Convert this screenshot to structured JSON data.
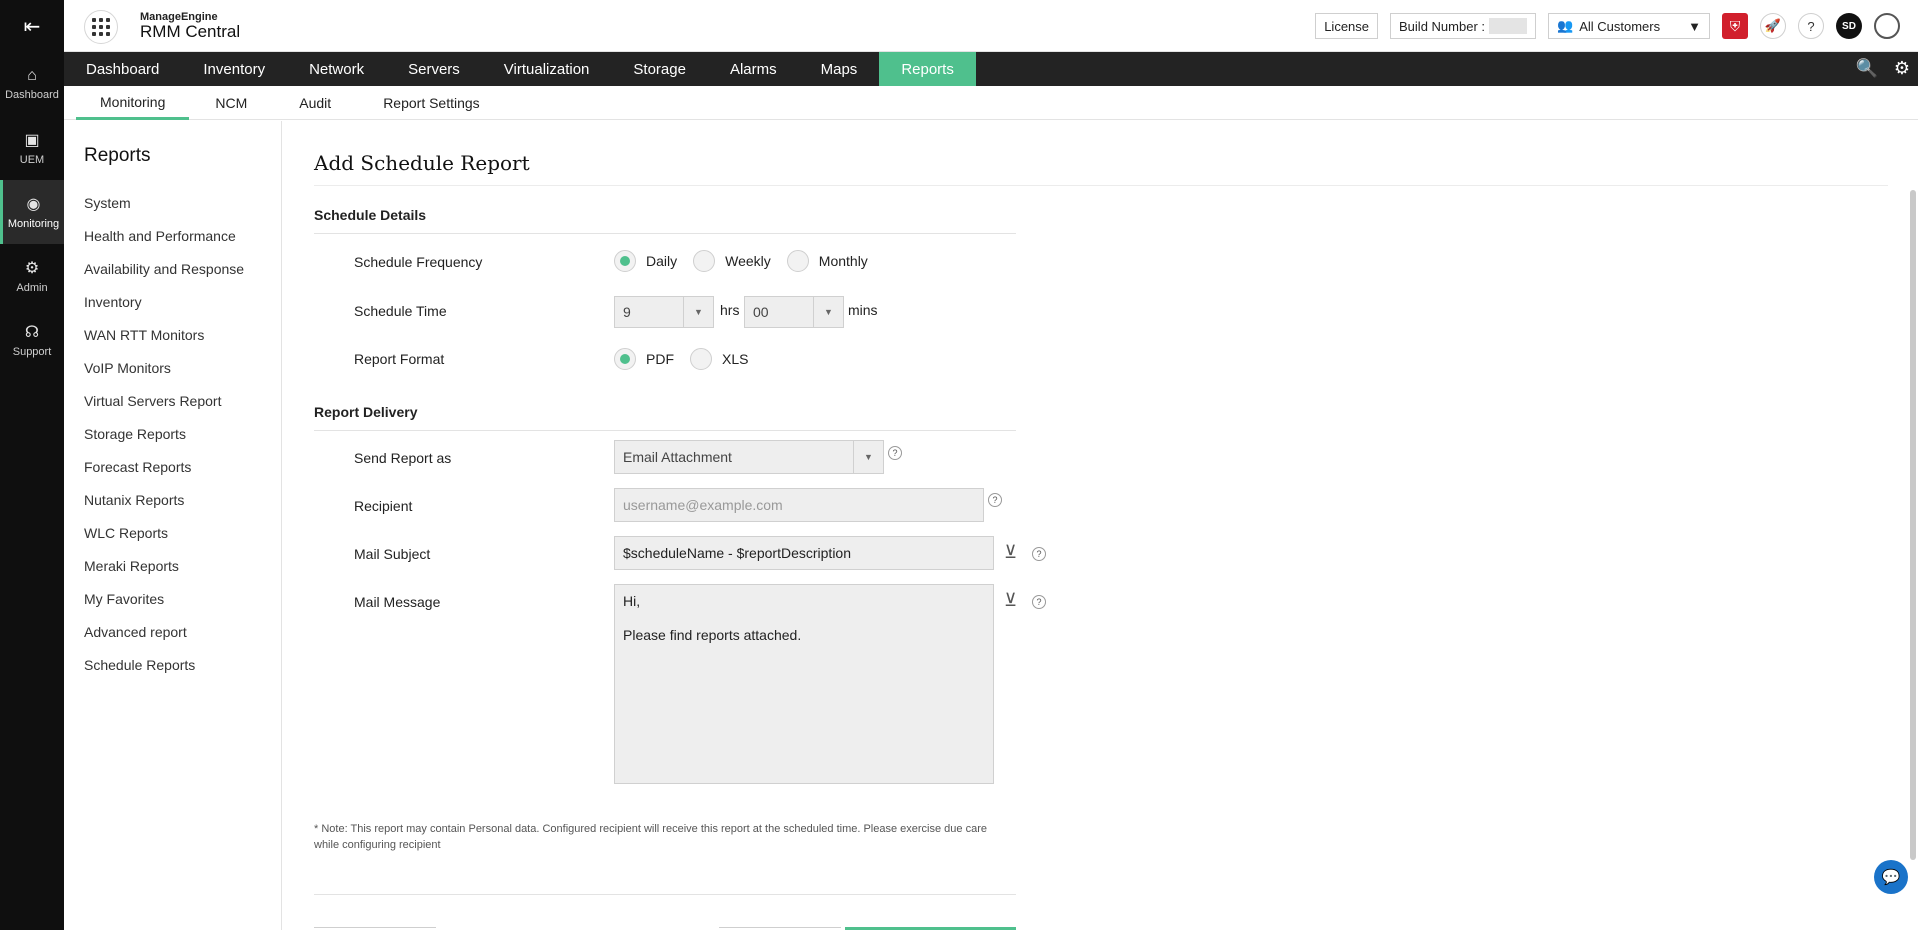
{
  "rail": {
    "items": [
      {
        "label": "Dashboard",
        "icon": "home-icon"
      },
      {
        "label": "UEM",
        "icon": "uem-icon"
      },
      {
        "label": "Monitoring",
        "icon": "monitoring-icon"
      },
      {
        "label": "Admin",
        "icon": "admin-icon"
      },
      {
        "label": "Support",
        "icon": "headset-icon"
      }
    ]
  },
  "brand": {
    "small": "ManageEngine",
    "big": "RMM Central"
  },
  "topbar": {
    "license": "License",
    "build_label": "Build Number :",
    "customer": "All Customers",
    "avatar": "SD"
  },
  "nav": {
    "items": [
      "Dashboard",
      "Inventory",
      "Network",
      "Servers",
      "Virtualization",
      "Storage",
      "Alarms",
      "Maps",
      "Reports"
    ]
  },
  "subnav": {
    "items": [
      "Monitoring",
      "NCM",
      "Audit",
      "Report Settings"
    ]
  },
  "sidebar": {
    "title": "Reports",
    "items": [
      "System",
      "Health and Performance",
      "Availability and Response",
      "Inventory",
      "WAN RTT Monitors",
      "VoIP Monitors",
      "Virtual Servers Report",
      "Storage Reports",
      "Forecast Reports",
      "Nutanix Reports",
      "WLC Reports",
      "Meraki Reports",
      "My Favorites",
      "Advanced report",
      "Schedule Reports"
    ]
  },
  "form": {
    "title": "Add Schedule Report",
    "schedule_details": "Schedule Details",
    "frequency_label": "Schedule Frequency",
    "freq_daily": "Daily",
    "freq_weekly": "Weekly",
    "freq_monthly": "Monthly",
    "time_label": "Schedule Time",
    "hours_value": "9",
    "hrs": "hrs",
    "mins_value": "00",
    "mins": "mins",
    "format_label": "Report Format",
    "fmt_pdf": "PDF",
    "fmt_xls": "XLS",
    "report_delivery": "Report Delivery",
    "send_as_label": "Send Report as",
    "send_as_value": "Email Attachment",
    "recipient_label": "Recipient",
    "recipient_placeholder": "username@example.com",
    "subject_label": "Mail Subject",
    "subject_value": "$scheduleName - $reportDescription",
    "message_label": "Mail Message",
    "message_value": "Hi,\n\nPlease find reports attached.",
    "help": "?",
    "note": "* Note: This report may contain Personal data. Configured recipient will receive this report at the scheduled time. Please exercise due care while configuring recipient"
  },
  "colors": {
    "accent": "#4fc08d",
    "nav_bg": "#232323",
    "rail_bg": "#0f0f0f",
    "shield": "#d11f2c",
    "chat": "#1a73c9"
  }
}
